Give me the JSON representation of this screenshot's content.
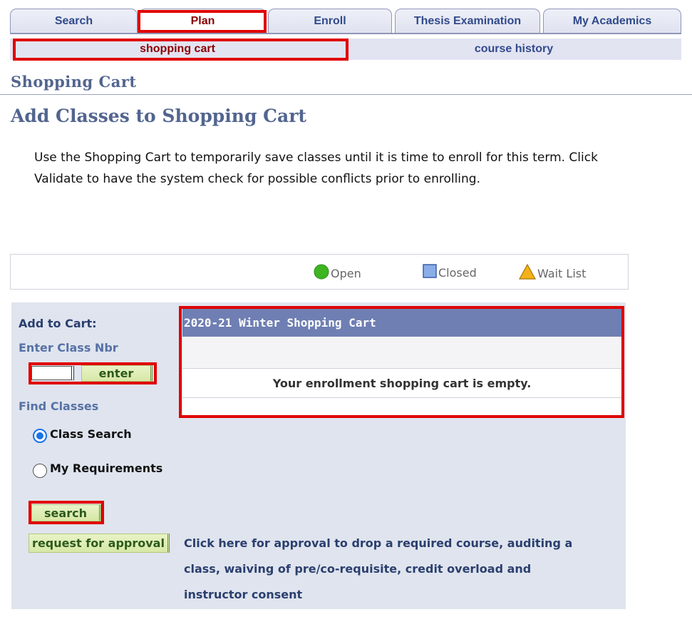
{
  "tabs": [
    {
      "label": "Search"
    },
    {
      "label": "Plan"
    },
    {
      "label": "Enroll"
    },
    {
      "label": "Thesis Examination"
    },
    {
      "label": "My Academics"
    }
  ],
  "subtabs": [
    {
      "label": "shopping cart"
    },
    {
      "label": "course history"
    }
  ],
  "page_title": "Shopping Cart",
  "section_title": "Add Classes to Shopping Cart",
  "instructions": "Use the Shopping Cart to temporarily save classes until it is time to enroll for this term.  Click Validate to have the system check for possible conflicts prior to enrolling.",
  "legend": {
    "open": "Open",
    "closed": "Closed",
    "wait_list": "Wait List"
  },
  "add_to_cart": {
    "heading": "Add to Cart:",
    "enter_class_nbr": "Enter Class Nbr",
    "class_nbr_value": "",
    "enter_button": "enter",
    "find_classes": "Find Classes",
    "options": [
      {
        "label": "Class Search",
        "checked": true
      },
      {
        "label": "My Requirements",
        "checked": false
      }
    ],
    "search_button": "search",
    "approval_button": "request for approval",
    "approval_text": "Click here for approval to drop a required course, auditing a class, waiving of pre/co-requisite, credit overload and instructor consent"
  },
  "cart": {
    "title": "2020-21 Winter Shopping Cart",
    "empty_message": "Your enrollment shopping cart is empty."
  },
  "colors": {
    "tab_text": "#314a8c",
    "active_tab_text": "#8a0000",
    "heading": "#52658f",
    "cart_header": "#6f7fb3",
    "panel_bg": "#dfe4ee",
    "highlight": "#e00000",
    "open_icon": "#3cb521",
    "closed_icon": "#8aaee8",
    "waitlist_icon": "#f3b21a"
  }
}
